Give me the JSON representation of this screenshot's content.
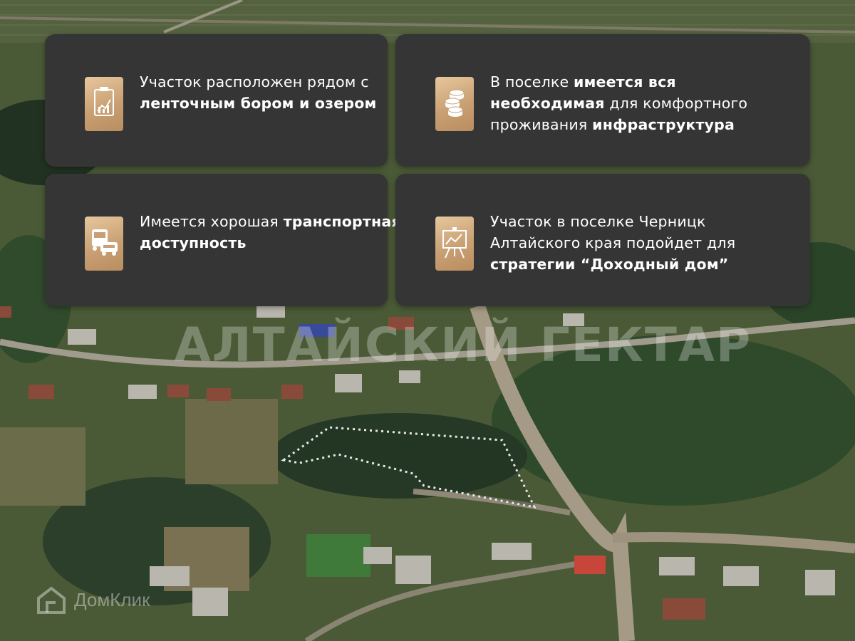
{
  "cards": [
    {
      "name": "card-location",
      "icon": "chart-clipboard-icon",
      "parts": [
        {
          "text": "Участок расположен рядом с ",
          "bold": false
        },
        {
          "text": "ленточным бором и озером",
          "bold": true
        }
      ]
    },
    {
      "name": "card-infrastructure",
      "icon": "coins-icon",
      "parts": [
        {
          "text": "В поселке ",
          "bold": false
        },
        {
          "text": "имеется вся необходимая",
          "bold": true
        },
        {
          "text": " для комфортного проживания ",
          "bold": false
        },
        {
          "text": "инфраструктура",
          "bold": true
        }
      ]
    },
    {
      "name": "card-transport",
      "icon": "transport-icon",
      "parts": [
        {
          "text": "Имеется хорошая ",
          "bold": false
        },
        {
          "text": "транспортная доступность",
          "bold": true
        }
      ]
    },
    {
      "name": "card-strategy",
      "icon": "presentation-board-icon",
      "parts": [
        {
          "text": "Участок  в поселке Черницк Алтайского края подойдет для ",
          "bold": false
        },
        {
          "text": "стратегии “Доходный дом”",
          "bold": true
        }
      ]
    }
  ],
  "watermark": "АЛТАЙСКИЙ ГЕКТАР",
  "logo_text": "ДомКлик",
  "colors": {
    "card_bg": "#353535",
    "icon_gold": "#c9a074",
    "plot_outline": "#e8e8e8"
  }
}
